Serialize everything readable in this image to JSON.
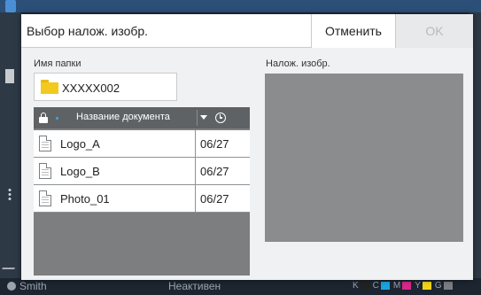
{
  "dialog": {
    "title": "Выбор налож. изобр.",
    "cancel_label": "Отменить",
    "ok_label": "OK"
  },
  "folder": {
    "label": "Имя папки",
    "name": "XXXXX002"
  },
  "document_list": {
    "column_name": "Название документа",
    "rows": [
      {
        "name": "Logo_A",
        "date": "06/27"
      },
      {
        "name": "Logo_B",
        "date": "06/27"
      },
      {
        "name": "Photo_01",
        "date": "06/27"
      }
    ]
  },
  "preview": {
    "label": "Налож. изобр."
  },
  "statusbar": {
    "user": "Smith",
    "state": "Неактивен",
    "toners": [
      {
        "letter": "K",
        "color": "#222222"
      },
      {
        "letter": "C",
        "color": "#1aa3df"
      },
      {
        "letter": "M",
        "color": "#d6278a"
      },
      {
        "letter": "Y",
        "color": "#f0d21a"
      },
      {
        "letter": "G",
        "color": "#7b7e80"
      }
    ]
  },
  "colors": {
    "accent": "#3da6e8",
    "folder": "#f2c91e",
    "header_dark": "#5f6265"
  }
}
